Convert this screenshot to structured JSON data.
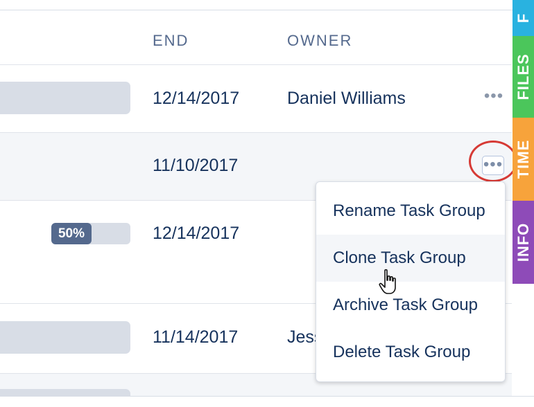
{
  "table": {
    "columns": {
      "end": "END",
      "owner": "OWNER"
    },
    "rows": [
      {
        "end": "12/14/2017",
        "owner": "Daniel Williams",
        "progress": null
      },
      {
        "end": "11/10/2017",
        "owner": "",
        "progress": null
      },
      {
        "end": "12/14/2017",
        "owner": "",
        "progress_label": "50%",
        "progress": 0.5
      },
      {
        "end": "11/14/2017",
        "owner": "Jess",
        "progress": null
      }
    ],
    "more_glyph": "•••"
  },
  "menu": {
    "items": [
      "Rename Task Group",
      "Clone Task Group",
      "Archive Task Group",
      "Delete Task Group"
    ],
    "hovered_index": 1
  },
  "side_tabs": [
    {
      "label": "F",
      "color": "#29b2e0"
    },
    {
      "label": "FILES",
      "color": "#4bc65b"
    },
    {
      "label": "TIME",
      "color": "#f7a33b"
    },
    {
      "label": "INFO",
      "color": "#8e4bb8"
    }
  ],
  "colors": {
    "text": "#16325c",
    "muted": "#54698d",
    "highlight": "#d63a35"
  }
}
